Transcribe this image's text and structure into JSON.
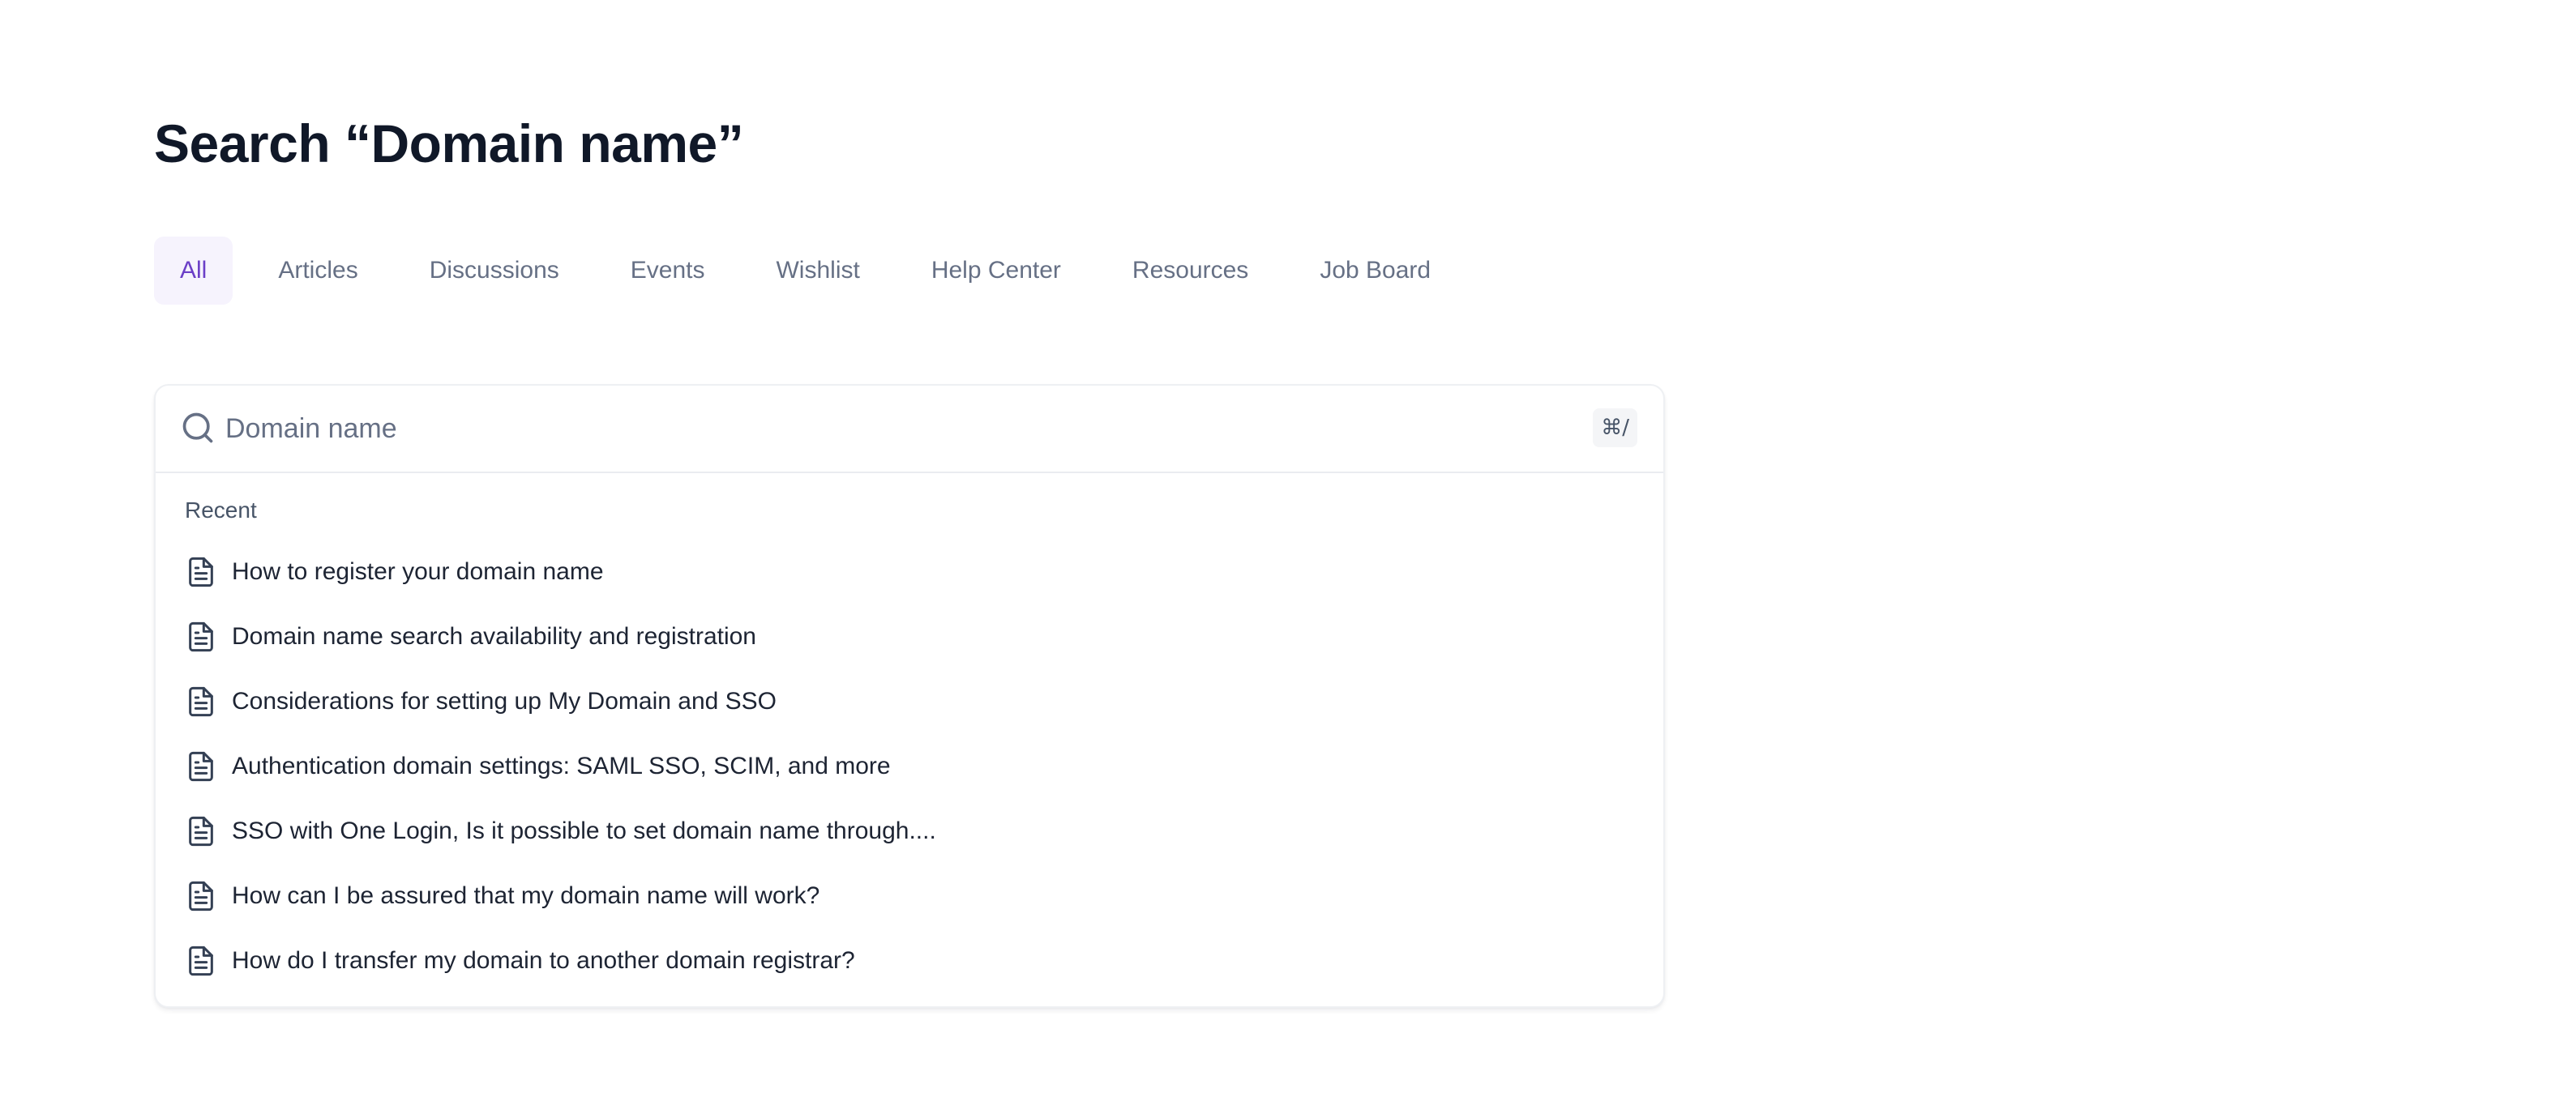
{
  "header": {
    "title": "Search “Domain name”"
  },
  "tabs": [
    {
      "label": "All",
      "active": true
    },
    {
      "label": "Articles",
      "active": false
    },
    {
      "label": "Discussions",
      "active": false
    },
    {
      "label": "Events",
      "active": false
    },
    {
      "label": "Wishlist",
      "active": false
    },
    {
      "label": "Help Center",
      "active": false
    },
    {
      "label": "Resources",
      "active": false
    },
    {
      "label": "Job Board",
      "active": false
    }
  ],
  "search": {
    "icon": "search-icon",
    "value": "Domain name",
    "placeholder": "Domain name",
    "shortcut": "⌘/"
  },
  "recent": {
    "label": "Recent",
    "icon": "document-icon",
    "items": [
      "How to register your domain name",
      "Domain name search availability and registration",
      "Considerations for setting up My Domain and SSO",
      "Authentication domain settings: SAML SSO, SCIM, and more",
      "SSO with One Login, Is it possible to set domain name through....",
      "How can I be assured that my domain name will work?",
      "How do I transfer my domain to another domain registrar?"
    ]
  },
  "colors": {
    "accent": "#6b3fc7",
    "active_tab_bg": "#f6f3fd",
    "title": "#101828",
    "muted_text": "#667085",
    "body_text": "#1d2433"
  }
}
